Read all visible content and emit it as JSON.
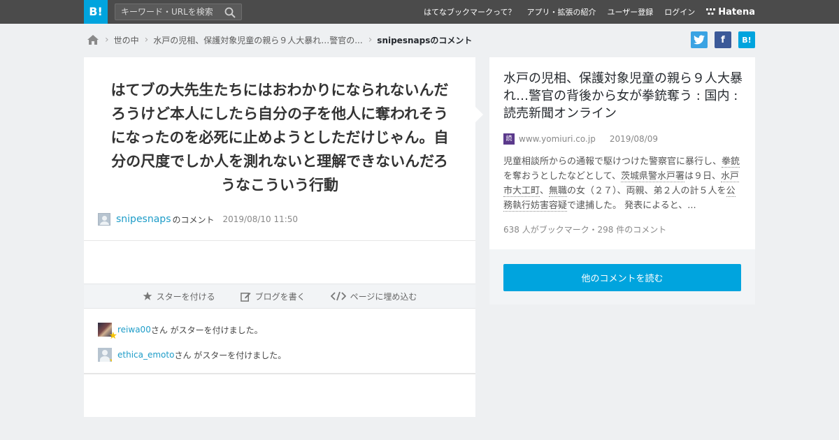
{
  "header": {
    "logo_text": "B!",
    "search_placeholder": "キーワード・URLを検索",
    "nav": {
      "about": "はてなブックマークって？",
      "apps": "アプリ・拡張の紹介",
      "register": "ユーザー登録",
      "login": "ログイン",
      "hatena": "Hatena"
    }
  },
  "breadcrumb": {
    "category": "世の中",
    "entry": "水戸の児相、保護対象児童の親ら９人大暴れ…警官の...",
    "current": "snipesnapsのコメント"
  },
  "share": {
    "twitter_glyph": "t",
    "facebook_glyph": "f",
    "hatena_glyph": "B!"
  },
  "comment": {
    "text": "はてブの大先生たちにはおわかりになられないんだろうけど本人にしたら自分の子を他人に奪われそうになったのを必死に止めようとしただけじゃん。自分の尺度でしか人を測れないと理解できないんだろうなこういう行動",
    "username": "snipesnaps",
    "username_suffix": "のコメント",
    "date": "2019/08/10 11:50"
  },
  "actions": {
    "star": "スターを付ける",
    "blog": "ブログを書く",
    "embed": "ページに埋め込む"
  },
  "stars": [
    {
      "user": "reiwa00",
      "text": "さん がスターを付けました。"
    },
    {
      "user": "ethica_emoto",
      "text": "さん がスターを付けました。"
    }
  ],
  "entry": {
    "title": "水戸の児相、保護対象児童の親ら９人大暴れ…警官の背後から女が拳銃奪う : 国内 : 読売新聞オンライン",
    "favicon_text": "読",
    "domain": "www.yomiuri.co.jp",
    "date": "2019/08/09",
    "summary": {
      "p1": "児童相談所からの通報で駆けつけた警察官に暴行し、",
      "k1": "拳銃",
      "p2": "を奪おうとしたなどとして、",
      "k2": "茨城県警水戸署",
      "p3": "は９日、",
      "k3": "水戸市大工町",
      "p4": "、",
      "k4": "無職",
      "p5": "の女（２７）、両親、弟２人の計５人を",
      "k5": "公務執行妨害容疑",
      "p6": "で逮捕した。 発表によると、..."
    },
    "counts": "638 人がブックマーク・298 件のコメント",
    "read_button": "他のコメントを読む"
  },
  "colors": {
    "accent": "#00a4de",
    "link": "#1d9cc8",
    "star": "#f5c400",
    "topbar": "#4b4b4b"
  }
}
